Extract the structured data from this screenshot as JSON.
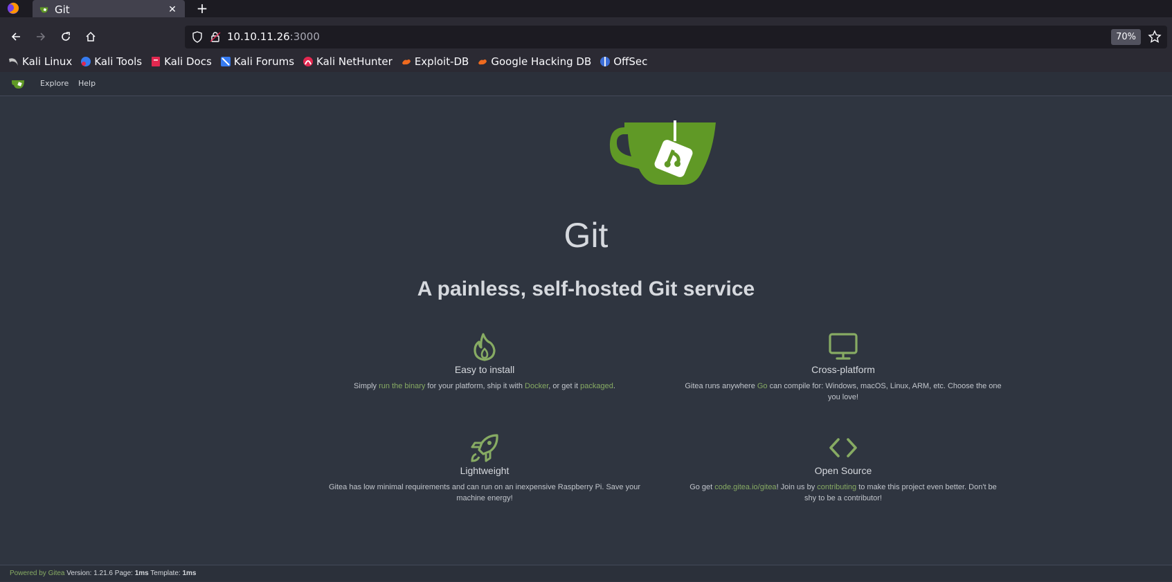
{
  "browser": {
    "tab": {
      "title": "Git",
      "close_glyph": "✕"
    },
    "new_tab_glyph": "+",
    "url": {
      "host": "10.10.11.26",
      "port": ":3000"
    },
    "zoom": "70%",
    "bookmarks": [
      {
        "label": "Kali Linux",
        "icon": "kali-dragon-icon"
      },
      {
        "label": "Kali Tools",
        "icon": "kali-tools-icon"
      },
      {
        "label": "Kali Docs",
        "icon": "kali-docs-icon"
      },
      {
        "label": "Kali Forums",
        "icon": "kali-forums-icon"
      },
      {
        "label": "Kali NetHunter",
        "icon": "kali-nethunter-icon"
      },
      {
        "label": "Exploit-DB",
        "icon": "exploit-db-icon"
      },
      {
        "label": "Google Hacking DB",
        "icon": "ghdb-icon"
      },
      {
        "label": "OffSec",
        "icon": "offsec-icon"
      }
    ]
  },
  "gitea_nav": {
    "explore": "Explore",
    "help": "Help"
  },
  "hero": {
    "title": "Git",
    "subtitle": "A painless, self-hosted Git service"
  },
  "features": {
    "install": {
      "heading": "Easy to install",
      "d1": "Simply ",
      "l1": "run the binary",
      "d2": " for your platform, ship it with ",
      "l2": "Docker",
      "d3": ", or get it ",
      "l3": "packaged",
      "d4": "."
    },
    "platform": {
      "heading": "Cross-platform",
      "d1": "Gitea runs anywhere ",
      "l1": "Go",
      "d2": " can compile for: Windows, macOS, Linux, ARM, etc. Choose the one you love!"
    },
    "lightweight": {
      "heading": "Lightweight",
      "d1": "Gitea has low minimal requirements and can run on an inexpensive Raspberry Pi. Save your machine energy!"
    },
    "opensource": {
      "heading": "Open Source",
      "d1": "Go get ",
      "l1": "code.gitea.io/gitea",
      "d2": "! Join us by ",
      "l2": "contributing",
      "d3": " to make this project even better. Don't be shy to be a contributor!"
    }
  },
  "footer": {
    "powered": "Powered by Gitea",
    "version": " Version: 1.21.6 Page: ",
    "page_time": "1ms",
    "template_label": " Template: ",
    "template_time": "1ms"
  },
  "colors": {
    "accent": "#609926",
    "link": "#87ab63",
    "page_bg": "#2f3540"
  }
}
